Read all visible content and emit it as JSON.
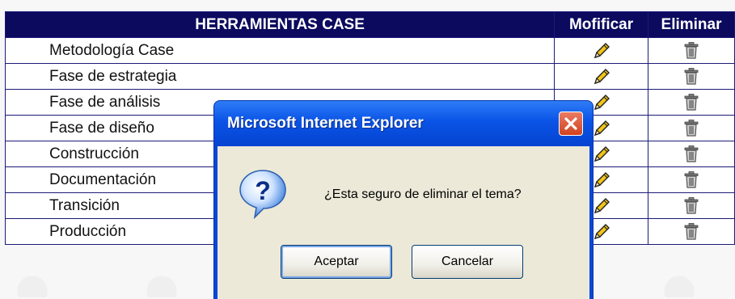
{
  "table": {
    "headers": [
      "HERRAMIENTAS CASE",
      "Mofificar",
      "Eliminar"
    ],
    "rows": [
      {
        "name": "Metodología Case"
      },
      {
        "name": "Fase de estrategia"
      },
      {
        "name": "Fase de análisis"
      },
      {
        "name": "Fase de diseño"
      },
      {
        "name": "Construcción"
      },
      {
        "name": "Documentación"
      },
      {
        "name": "Transición"
      },
      {
        "name": "Producción"
      }
    ],
    "icons": {
      "edit": "pencil-icon",
      "delete": "trash-icon"
    }
  },
  "dialog": {
    "title": "Microsoft Internet Explorer",
    "message": "¿Esta seguro de eliminar el tema?",
    "ok_label": "Aceptar",
    "cancel_label": "Cancelar",
    "icon": "question-icon"
  },
  "colors": {
    "header_bg": "#0b0a5e",
    "titlebar": "#0a53e6",
    "close": "#d2431f"
  }
}
